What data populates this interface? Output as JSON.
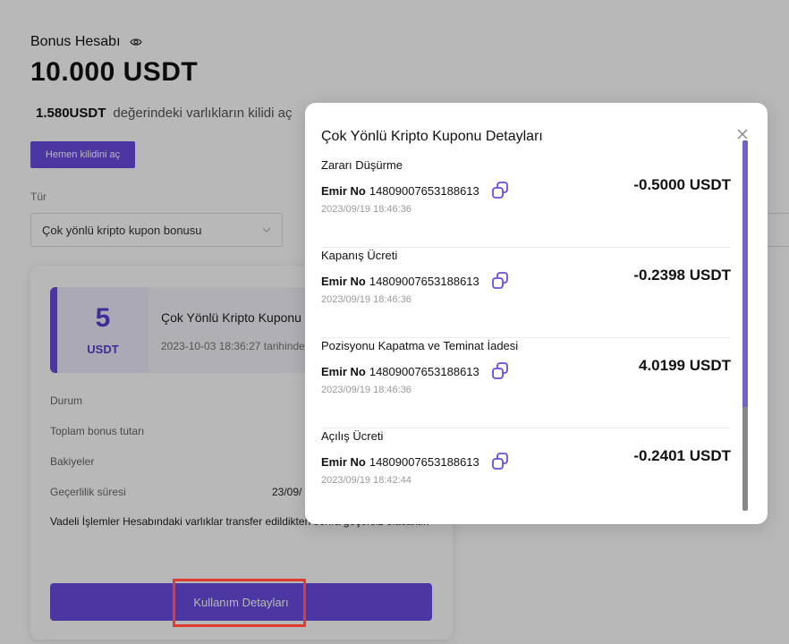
{
  "account": {
    "title": "Bonus Hesabı",
    "balance": "10.000 USDT",
    "locked_amount": "1.580USDT",
    "locked_text": "değerindeki varlıkların kilidi aç",
    "unlock_button": "Hemen kilidini aç"
  },
  "filter": {
    "type_label": "Tür",
    "type_value": "Çok yönlü kripto kupon bonusu"
  },
  "coupon_card": {
    "amount": "5",
    "unit": "USDT",
    "name": "Çok Yönlü Kripto Kuponu",
    "expiry_text": "2023-10-03 18:36:27 tarihinde",
    "rows": [
      {
        "label": "Durum",
        "value": ""
      },
      {
        "label": "Toplam bonus tutarı",
        "value": ""
      },
      {
        "label": "Bakiyeler",
        "value": ""
      },
      {
        "label": "Geçerlilik süresi",
        "value": "23/09/"
      }
    ],
    "note": "Vadeli İşlemler Hesabındaki varlıklar transfer edildikten sonra geçersiz olacaktır.",
    "usage_button": "Kullanım Detayları"
  },
  "modal": {
    "title": "Çok Yönlü Kripto Kuponu Detayları",
    "order_label": "Emir No",
    "transactions": [
      {
        "type": "Zararı Düşürme",
        "order_no": "14809007653188613",
        "date": "2023/09/19 18:46:36",
        "amount": "-0.5000 USDT"
      },
      {
        "type": "Kapanış Ücreti",
        "order_no": "14809007653188613",
        "date": "2023/09/19 18:46:36",
        "amount": "-0.2398 USDT"
      },
      {
        "type": "Pozisyonu Kapatma ve Teminat İadesi",
        "order_no": "14809007653188613",
        "date": "2023/09/19 18:46:36",
        "amount": "4.0199 USDT"
      },
      {
        "type": "Açılış Ücreti",
        "order_no": "14809007653188613",
        "date": "2023/09/19 18:42:44",
        "amount": "-0.2401 USDT"
      }
    ]
  },
  "colors": {
    "accent": "#6a4be0",
    "highlight": "#e03b2f"
  }
}
